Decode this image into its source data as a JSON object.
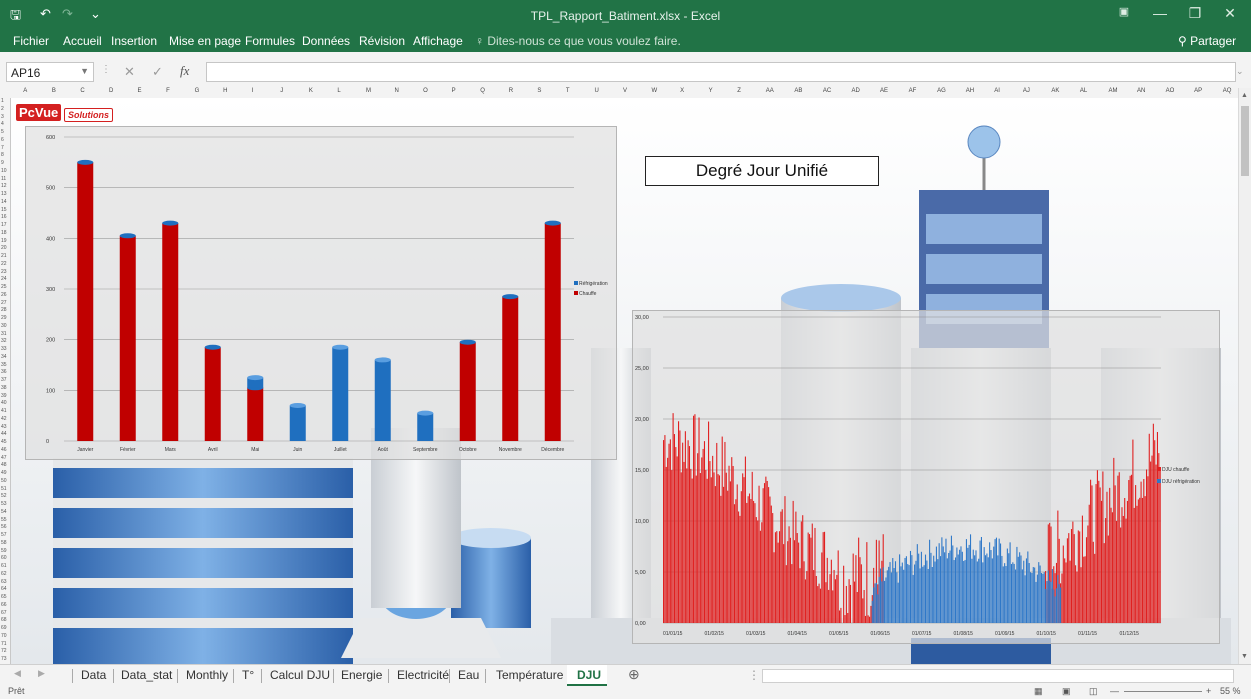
{
  "window": {
    "title": "TPL_Rapport_Batiment.xlsx - Excel",
    "qat": {
      "save": "🖫",
      "undo": "↶",
      "redo": "↷",
      "customize": "⌄"
    },
    "controls": {
      "ribbon_display": "▣",
      "minimize": "—",
      "restore": "❐",
      "close": "✕"
    }
  },
  "ribbon": {
    "tabs": [
      "Fichier",
      "Accueil",
      "Insertion",
      "Mise en page",
      "Formules",
      "Données",
      "Révision",
      "Affichage"
    ],
    "tell_me": "Dites-nous ce que vous voulez faire.",
    "share": "Partager"
  },
  "formula_bar": {
    "name_box": "AP16",
    "fx": "fx",
    "cancel": "✕",
    "enter": "✓",
    "value": ""
  },
  "columns": [
    "A",
    "B",
    "C",
    "D",
    "E",
    "F",
    "G",
    "H",
    "I",
    "J",
    "K",
    "L",
    "M",
    "N",
    "O",
    "P",
    "Q",
    "R",
    "S",
    "T",
    "U",
    "V",
    "W",
    "X",
    "Y",
    "Z",
    "AA",
    "AB",
    "AC",
    "AD",
    "AE",
    "AF",
    "AG",
    "AH",
    "AI",
    "AJ",
    "AK",
    "AL",
    "AM",
    "AN",
    "AO",
    "AP",
    "AQ"
  ],
  "rows_count": 73,
  "logo": {
    "primary": "PcVue",
    "secondary": "Solutions"
  },
  "dju_title": "Degré Jour Unifié",
  "chart_data": [
    {
      "type": "bar",
      "stacked": true,
      "categories": [
        "Janvier",
        "Février",
        "Mars",
        "Avril",
        "Mai",
        "Juin",
        "Juillet",
        "Août",
        "Septembre",
        "Octobre",
        "Novembre",
        "Décembre"
      ],
      "series": [
        {
          "name": "Chauffe",
          "color": "#c00000",
          "values": [
            550,
            405,
            430,
            185,
            105,
            0,
            0,
            0,
            0,
            195,
            285,
            430
          ]
        },
        {
          "name": "Réfrigération",
          "color": "#1f6fbf",
          "values": [
            0,
            0,
            0,
            0,
            20,
            70,
            185,
            160,
            55,
            0,
            0,
            0
          ]
        }
      ],
      "ylim": [
        0,
        600
      ],
      "yticks": [
        "0",
        "100",
        "200",
        "300",
        "400",
        "500",
        "600"
      ],
      "legend": "right",
      "grid": true
    },
    {
      "type": "bar",
      "stacked": false,
      "x_range": [
        "01/01/15",
        "31/12/15"
      ],
      "xticks": [
        "01/01/15",
        "01/02/15",
        "01/03/15",
        "01/04/15",
        "01/05/15",
        "01/06/15",
        "01/07/15",
        "01/08/15",
        "01/09/15",
        "01/10/15",
        "01/11/15",
        "01/12/15"
      ],
      "series": [
        {
          "name": "DJU chauffe",
          "color": "#e02020"
        },
        {
          "name": "DJU réfrigération",
          "color": "#2f78c8"
        }
      ],
      "ylim": [
        0,
        30
      ],
      "yticks": [
        "0,00",
        "5,00",
        "10,00",
        "15,00",
        "20,00",
        "25,00",
        "30,00"
      ],
      "legend": "right",
      "grid": true,
      "note": ""
    }
  ],
  "sheet_tabs": [
    "Data",
    "Data_stat",
    "Monthly",
    "T°",
    "Calcul DJU",
    "Energie",
    "Electricité",
    "Eau",
    "Température",
    "DJU"
  ],
  "active_tab": "DJU",
  "status": {
    "ready": "Prêt",
    "zoom": "55 %"
  }
}
